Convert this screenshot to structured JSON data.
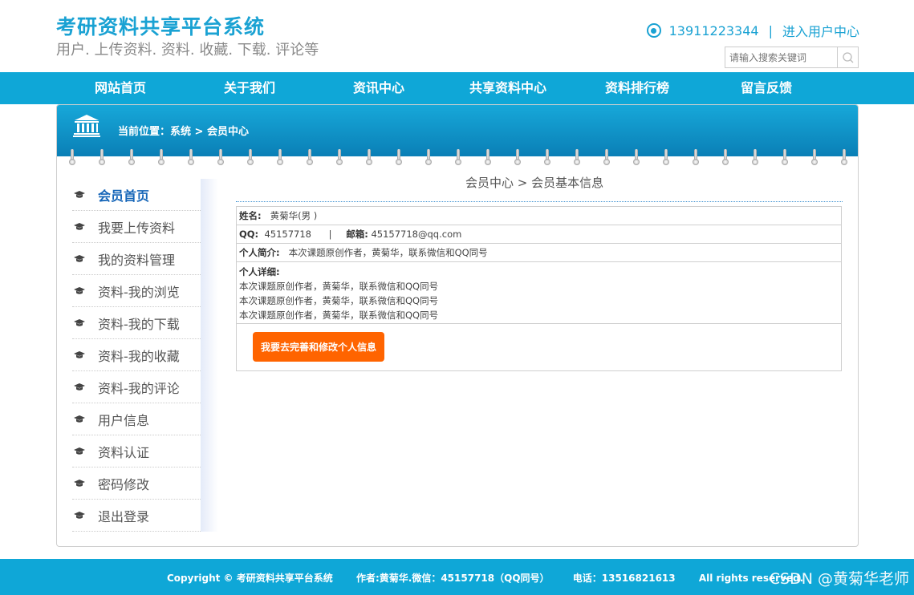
{
  "header": {
    "title": "考研资料共享平台系统",
    "subtitle": "用户. 上传资料. 资料. 收藏. 下载. 评论等",
    "phone": "13911223344",
    "separator": "|",
    "user_center_link": "进入用户中心",
    "search_placeholder": "请输入搜索关键词"
  },
  "nav": {
    "items": [
      {
        "label": "网站首页"
      },
      {
        "label": "关于我们"
      },
      {
        "label": "资讯中心"
      },
      {
        "label": "共享资料中心"
      },
      {
        "label": "资料排行榜"
      },
      {
        "label": "留言反馈"
      }
    ]
  },
  "banner": {
    "breadcrumb": "当前位置：系统 > 会员中心"
  },
  "sidebar": {
    "items": [
      {
        "label": "会员首页",
        "active": true
      },
      {
        "label": "我要上传资料"
      },
      {
        "label": "我的资料管理"
      },
      {
        "label": "资料-我的浏览"
      },
      {
        "label": "资料-我的下载"
      },
      {
        "label": "资料-我的收藏"
      },
      {
        "label": "资料-我的评论"
      },
      {
        "label": "用户信息"
      },
      {
        "label": "资料认证"
      },
      {
        "label": "密码修改"
      },
      {
        "label": "退出登录"
      }
    ]
  },
  "main": {
    "title": "会员中心 > 会员基本信息",
    "name_label": "姓名:",
    "name_value": "黄菊华(男 )",
    "qq_label": "QQ:",
    "qq_value": "45157718",
    "row_sep": "|",
    "email_label": "邮箱:",
    "email_value": "45157718@qq.com",
    "intro_label": "个人简介:",
    "intro_value": "本次课题原创作者，黄菊华，联系微信和QQ同号",
    "detail_label": "个人详细:",
    "detail_lines": [
      "本次课题原创作者，黄菊华，联系微信和QQ同号",
      "本次课题原创作者，黄菊华，联系微信和QQ同号",
      "本次课题原创作者，黄菊华，联系微信和QQ同号"
    ],
    "edit_button": "我要去完善和修改个人信息"
  },
  "footer": {
    "text": "Copyright © 考研资料共享平台系统       作者:黄菊华.微信：45157718（QQ同号）       电话：13516821613       All rights reserved.",
    "watermark": "CSDN @黄菊华老师"
  },
  "colors": {
    "brand": "#0fa7d7",
    "title": "#1aa2d3",
    "button": "#ff6400",
    "active_link": "#1565b8"
  }
}
